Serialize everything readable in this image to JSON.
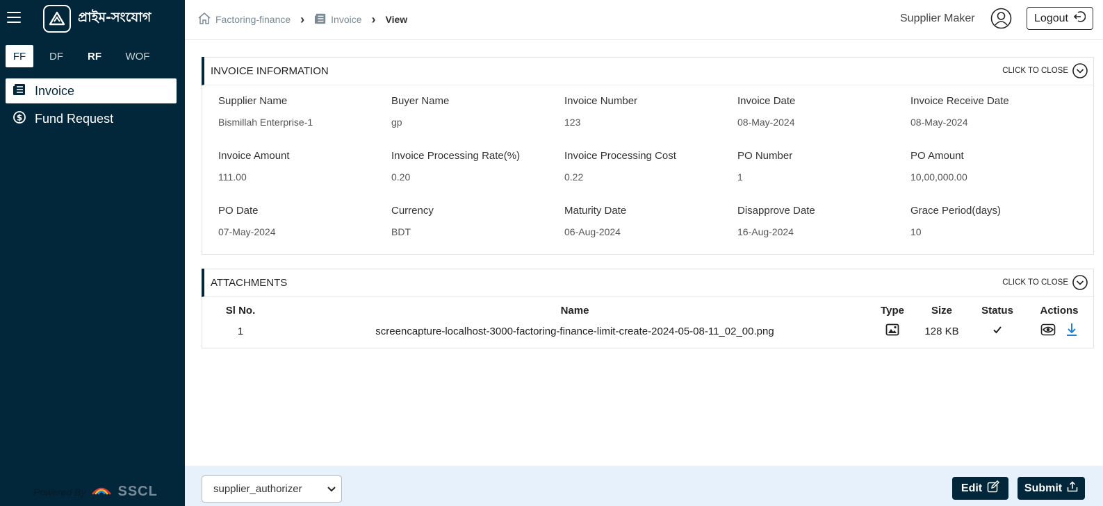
{
  "brand": {
    "name": "প্রাইম-সংযোগ"
  },
  "tabs": [
    {
      "label": "FF"
    },
    {
      "label": "DF"
    },
    {
      "label": "RF"
    },
    {
      "label": "WOF"
    }
  ],
  "nav": [
    {
      "label": "Invoice",
      "icon": "invoice-icon"
    },
    {
      "label": "Fund Request",
      "icon": "dollar-coin-icon"
    }
  ],
  "powered": {
    "text": "Powered By",
    "logo": "SSCL"
  },
  "breadcrumb": [
    {
      "label": "Factoring-finance",
      "icon": "home-icon"
    },
    {
      "label": "Invoice",
      "icon": "invoice-icon"
    },
    {
      "label": "View"
    }
  ],
  "header": {
    "user": "Supplier Maker",
    "logout": "Logout"
  },
  "invoice_info": {
    "title": "INVOICE INFORMATION",
    "collapse_label": "CLICK TO CLOSE",
    "fields": [
      {
        "label": "Supplier Name",
        "value": "Bismillah Enterprise-1"
      },
      {
        "label": "Buyer Name",
        "value": "gp"
      },
      {
        "label": "Invoice Number",
        "value": "123"
      },
      {
        "label": "Invoice Date",
        "value": "08-May-2024"
      },
      {
        "label": "Invoice Receive Date",
        "value": "08-May-2024"
      },
      {
        "label": "Invoice Amount",
        "value": "111.00"
      },
      {
        "label": "Invoice Processing Rate(%)",
        "value": "0.20"
      },
      {
        "label": "Invoice Processing Cost",
        "value": "0.22"
      },
      {
        "label": "PO Number",
        "value": "1"
      },
      {
        "label": "PO Amount",
        "value": "10,00,000.00"
      },
      {
        "label": "PO Date",
        "value": "07-May-2024"
      },
      {
        "label": "Currency",
        "value": "BDT"
      },
      {
        "label": "Maturity Date",
        "value": "06-Aug-2024"
      },
      {
        "label": "Disapprove Date",
        "value": "16-Aug-2024"
      },
      {
        "label": "Grace Period(days)",
        "value": "10"
      }
    ]
  },
  "attachments": {
    "title": "ATTACHMENTS",
    "collapse_label": "CLICK TO CLOSE",
    "columns": [
      "Sl No.",
      "Name",
      "Type",
      "Size",
      "Status",
      "Actions"
    ],
    "rows": [
      {
        "sl": "1",
        "name": "screencapture-localhost-3000-factoring-finance-limit-create-2024-05-08-11_02_00.png",
        "type_icon": "image-file-icon",
        "size": "128 KB",
        "status_icon": "check-icon"
      }
    ]
  },
  "footer": {
    "select_value": "supplier_authorizer",
    "edit_label": "Edit",
    "submit_label": "Submit"
  },
  "colors": {
    "sidebar": "#02273a",
    "footer": "#e6f1fb",
    "accent_download": "#1e7fd6"
  }
}
